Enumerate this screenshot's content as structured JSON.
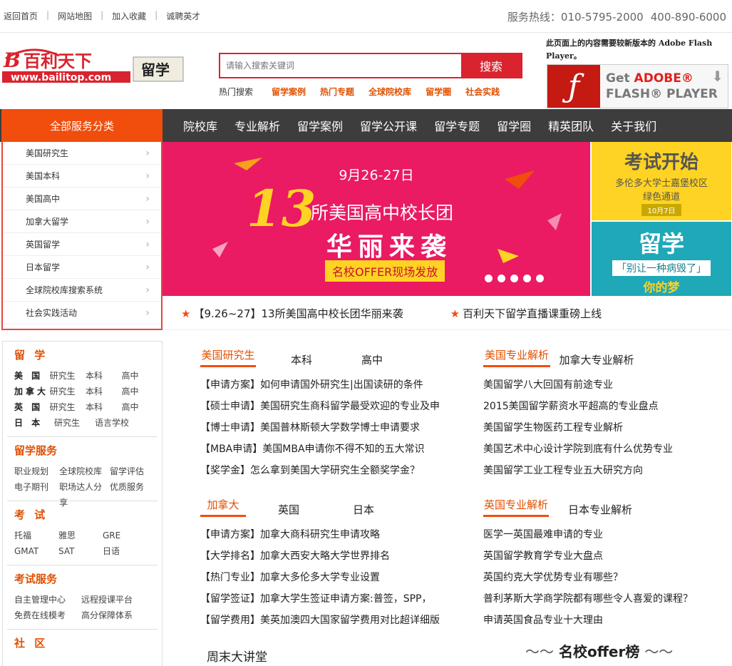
{
  "topbar": {
    "links": [
      "返回首页",
      "网站地图",
      "加入收藏",
      "诚聘英才"
    ],
    "hotline_label": "服务热线：",
    "phones": [
      "010-5795-2000",
      "400-890-6000"
    ]
  },
  "logo": {
    "brand": "百利天下",
    "url_text": "www.bailitop.com",
    "badge": "留学"
  },
  "search": {
    "placeholder": "请输入搜索关键词",
    "button": "搜索"
  },
  "hot_search": {
    "label": "热门搜索",
    "items": [
      "留学案例",
      "热门专题",
      "全球院校库",
      "留学圈",
      "社会实践"
    ]
  },
  "flash": {
    "note": "此页面上的内容需要较新版本的 Adobe Flash Player。",
    "get": "Get",
    "adobe": "ADOBE",
    "player": "FLASH® PLAYER"
  },
  "nav": {
    "all_label": "全部服务分类",
    "items": [
      "院校库",
      "专业解析",
      "留学案例",
      "留学公开课",
      "留学专题",
      "留学圈",
      "精英团队",
      "关于我们"
    ]
  },
  "categories": [
    "美国研究生",
    "美国本科",
    "美国高中",
    "加拿大留学",
    "英国留学",
    "日本留学",
    "全球院校库搜索系统",
    "社会实践活动"
  ],
  "banner": {
    "date": "9月26-27日",
    "number": "13",
    "line1": "所美国高中校长团",
    "line2": "华丽来袭",
    "line3": "名校OFFER现场发放"
  },
  "ad_exam": {
    "title": "考试开始",
    "line1": "多伦多大学士嘉堡校区",
    "line2": "绿色通道",
    "date": "10月7日"
  },
  "ad_abroad": {
    "title": "留学",
    "line1": "「别让一种病毁了」",
    "line2": "你的梦"
  },
  "news": [
    "【9.26~27】13所美国高中校长团华丽来袭",
    "百利天下留学直播课重磅上线"
  ],
  "sidebar": {
    "abroad_title": "留 学",
    "abroad_rows": [
      {
        "k": "美 国",
        "v": [
          "研究生",
          "本科",
          "高中"
        ]
      },
      {
        "k": "加拿大",
        "v": [
          "研究生",
          "本科",
          "高中"
        ]
      },
      {
        "k": "英 国",
        "v": [
          "研究生",
          "本科",
          "高中"
        ]
      },
      {
        "k": "日 本",
        "v": [
          "研究生",
          "语言学校"
        ]
      }
    ],
    "service_title": "留学服务",
    "service_rows": [
      [
        "职业规划",
        "全球院校库",
        "留学评估"
      ],
      [
        "电子期刊",
        "职场达人分享",
        "优质服务"
      ]
    ],
    "exam_title": "考 试",
    "exam_rows": [
      [
        "托福",
        "雅思",
        "GRE"
      ],
      [
        "GMAT",
        "SAT",
        "日语"
      ]
    ],
    "exam_service_title": "考试服务",
    "exam_service_rows": [
      [
        "自主管理中心",
        "远程授课平台"
      ],
      [
        "免费在线模考",
        "高分保障体系"
      ]
    ],
    "community_title": "社 区"
  },
  "us_tabs": [
    "美国研究生",
    "本科",
    "高中"
  ],
  "us_list": [
    "【申请方案】如何申请国外研究生|出国读研的条件",
    "【硕士申请】美国研究生商科留学最受欢迎的专业及申",
    "【博士申请】美国普林斯顿大学数学博士申请要求",
    "【MBA申请】美国MBA申请你不得不知的五大常识",
    "【奖学金】怎么拿到美国大学研究生全额奖学金？"
  ],
  "us_major_tabs": [
    "美国专业解析",
    "加拿大专业解析"
  ],
  "us_major_list": [
    "美国留学八大回国有前途专业",
    "2015美国留学薪资水平超高的专业盘点",
    "美国留学生物医药工程专业解析",
    "美国艺术中心设计学院到底有什么优势专业",
    "美国留学工业工程专业五大研究方向"
  ],
  "ca_tabs": [
    "加拿大",
    "英国",
    "日本"
  ],
  "ca_list": [
    "【申请方案】加拿大商科研究生申请攻略",
    "【大学排名】加拿大西安大略大学世界排名",
    "【热门专业】加拿大多伦多大学专业设置",
    "【留学签证】加拿大学生签证申请方案:普签，SPP，",
    "【留学费用】美英加澳四大国家留学费用对比超详细版"
  ],
  "uk_major_tabs": [
    "英国专业解析",
    "日本专业解析"
  ],
  "uk_major_list": [
    "医学一英国最难申请的专业",
    "英国留学教育学专业大盘点",
    "英国约克大学优势专业有哪些？",
    "普利茅斯大学商学院都有哪些令人喜爱的课程？",
    "申请英国食品专业十大理由"
  ],
  "lecture": "周末大讲堂",
  "offer": "名校offer榜",
  "colors": {
    "accent": "#f14d0c",
    "red": "#d9232e",
    "nav": "#3d3d3d",
    "banner": "#ea1a63"
  }
}
